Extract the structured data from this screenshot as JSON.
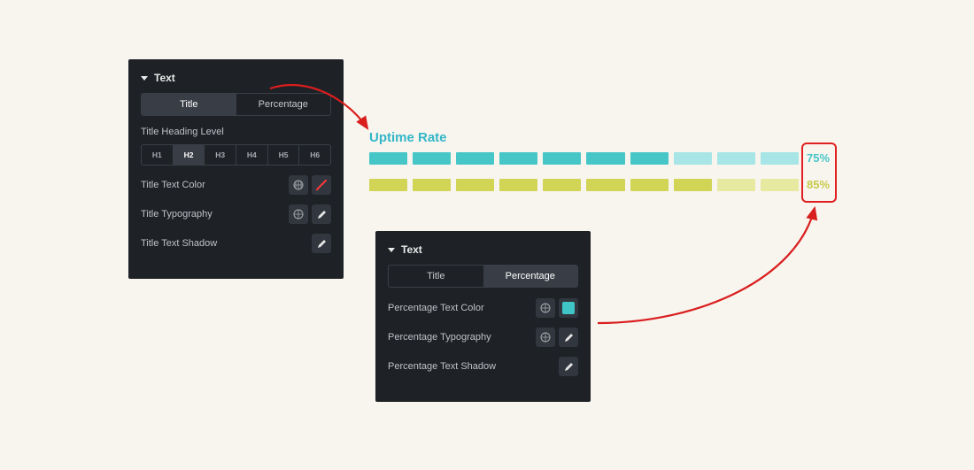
{
  "panel1": {
    "section": "Text",
    "tab_title": "Title",
    "tab_percentage": "Percentage",
    "heading_level_label": "Title Heading Level",
    "h_options": [
      "H1",
      "H2",
      "H3",
      "H4",
      "H5",
      "H6"
    ],
    "row_color": "Title Text Color",
    "row_typo": "Title Typography",
    "row_shadow": "Title Text Shadow"
  },
  "panel2": {
    "section": "Text",
    "tab_title": "Title",
    "tab_percentage": "Percentage",
    "row_color": "Percentage Text Color",
    "row_typo": "Percentage Typography",
    "row_shadow": "Percentage Text Shadow"
  },
  "preview": {
    "title": "Uptime Rate",
    "pct1": "75%",
    "pct2": "85%",
    "bar1_filled": 7,
    "bar2_filled": 8,
    "segments": 10,
    "color1": "#47c6c8",
    "color2": "#d1d455"
  }
}
